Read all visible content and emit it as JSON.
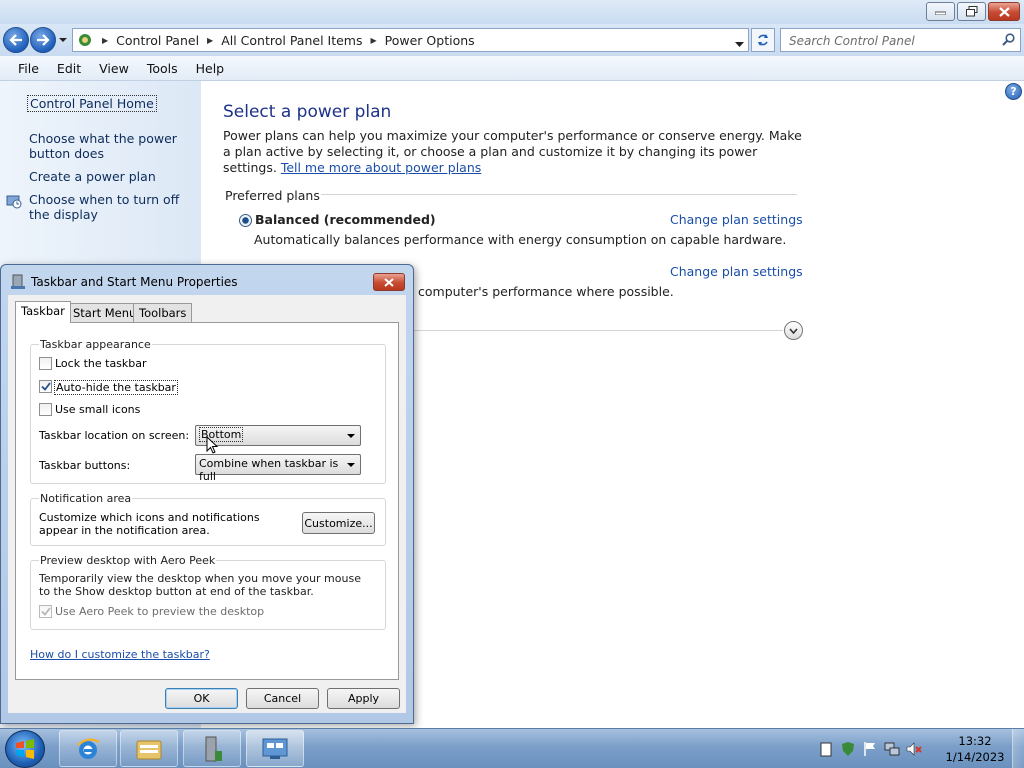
{
  "window": {
    "address": [
      "Control Panel",
      "All Control Panel Items",
      "Power Options"
    ],
    "search_placeholder": "Search Control Panel"
  },
  "menu": [
    "File",
    "Edit",
    "View",
    "Tools",
    "Help"
  ],
  "left_pane": {
    "home": "Control Panel Home",
    "power_button": "Choose what the power button does",
    "create_plan": "Create a power plan",
    "display_off": "Choose when to turn off the display"
  },
  "main": {
    "heading": "Select a power plan",
    "intro": "Power plans can help you maximize your computer's performance or conserve energy. Make a plan active by selecting it, or choose a plan and customize it by changing its power settings.",
    "intro_link": "Tell me more about power plans",
    "preferred_heading": "Preferred plans",
    "plan1_name": "Balanced (recommended)",
    "plan1_desc": "Automatically balances performance with energy consumption on capable hardware.",
    "change_link": "Change plan settings",
    "plan2_desc": "computer's performance where possible."
  },
  "dialog": {
    "title": "Taskbar and Start Menu Properties",
    "tabs": [
      "Taskbar",
      "Start Menu",
      "Toolbars"
    ],
    "appearance_title": "Taskbar appearance",
    "lock_label": "Lock the taskbar",
    "autohide_label": "Auto-hide the taskbar",
    "small_icons_label": "Use small icons",
    "location_label": "Taskbar location on screen:",
    "location_value": "Bottom",
    "buttons_label": "Taskbar buttons:",
    "buttons_value": "Combine when taskbar is full",
    "notify_title": "Notification area",
    "notify_text": "Customize which icons and notifications appear in the notification area.",
    "customize_label": "Customize...",
    "peek_title": "Preview desktop with Aero Peek",
    "peek_text": "Temporarily view the desktop when you move your mouse to the Show desktop button at end of the taskbar.",
    "peek_checkbox_label": "Use Aero Peek to preview the desktop",
    "howto_link": "How do I customize the taskbar?",
    "ok": "OK",
    "cancel": "Cancel",
    "apply": "Apply",
    "checked": {
      "lock": false,
      "autohide": true,
      "small_icons": false,
      "peek": true
    }
  },
  "taskbar": {
    "time": "13:32",
    "date": "1/14/2023"
  }
}
